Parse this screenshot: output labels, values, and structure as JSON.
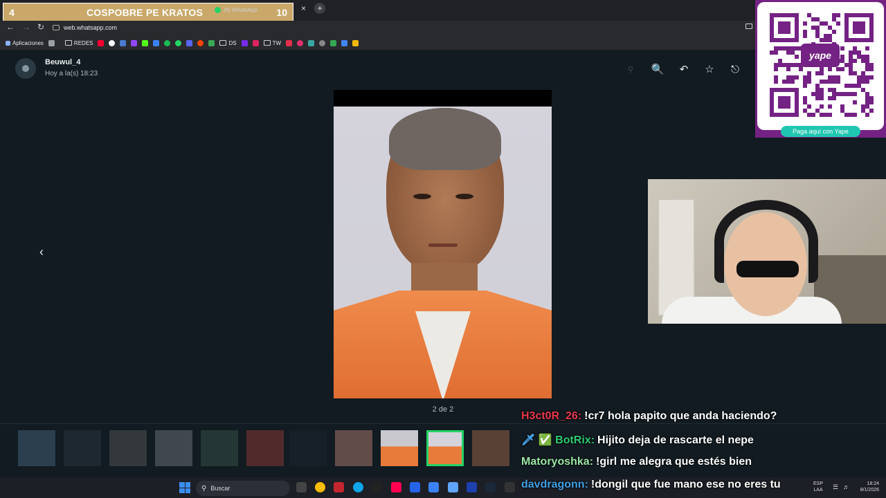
{
  "counter": {
    "left": "4",
    "title": "COSPOBRE PE KRATOS",
    "right": "10"
  },
  "browser": {
    "tab_title": "(4) WhatsApp",
    "tab_close": "×",
    "new_tab": "+",
    "url": "web.whatsapp.com",
    "bookmarks": {
      "apps": "Aplicaciones",
      "redes": "REDES",
      "ds": "DS",
      "tw": "TW"
    }
  },
  "viewer": {
    "sender_name": "Beuwul_4",
    "timestamp": "Hoy a la(s) 18:23",
    "counter": "2 de 2",
    "thumbnails_count": 11,
    "selected_thumbnail": 9
  },
  "qr": {
    "logo": "yape",
    "button": "Paga aquí con Yape",
    "colors": {
      "brand": "#742284",
      "pill": "#1fc7b1"
    }
  },
  "chat": [
    {
      "user": "H3ct0R_26:",
      "message": "!cr7 hola papito que anda haciendo?",
      "color": "#e6394c"
    },
    {
      "user": "BotRix:",
      "message": "Hijito deja de rascarte el nepe",
      "color": "#2ecc71",
      "badges": "🗡 ✅"
    },
    {
      "user": "Matoryoshka:",
      "message": "!girl me alegra que estés bien",
      "color": "#9be7a6"
    },
    {
      "user": "davdragonn:",
      "message": "!dongil que fue mano ese no eres tu",
      "color": "#3ea0e6"
    }
  ],
  "taskbar": {
    "search": "Buscar",
    "lang_top": "ESP",
    "lang_bottom": "LAA",
    "time": "18:24",
    "date": "8/1/2026"
  },
  "colors": {
    "whatsapp_bg": "#111b21",
    "accent": "#25d366"
  }
}
